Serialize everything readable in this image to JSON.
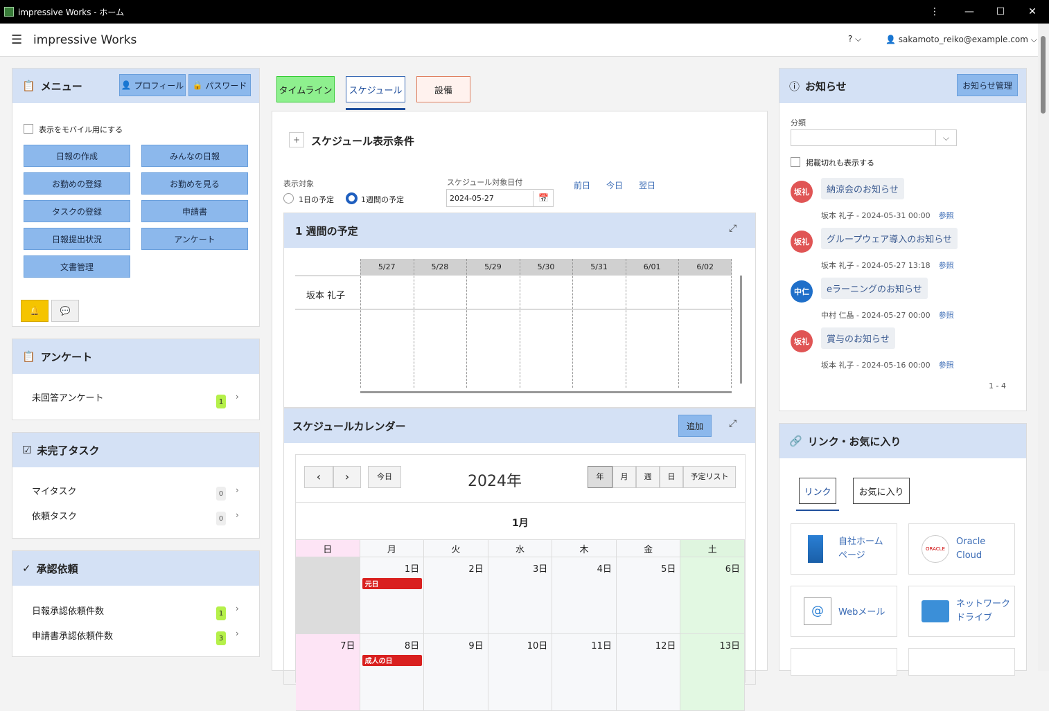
{
  "window": {
    "title": "impressive Works - ホーム",
    "more": "⋮",
    "min": "—",
    "max": "☐",
    "close": "✕"
  },
  "appbar": {
    "brand": "impressive Works",
    "help": "? ⌵",
    "user": "sakamoto_reiko@example.com"
  },
  "menu": {
    "title": "メニュー",
    "profile": "プロフィール",
    "password": "パスワード",
    "mobile_label": "表示をモバイル用にする",
    "buttons": [
      "日報の作成",
      "みんなの日報",
      "お勤めの登録",
      "お勤めを見る",
      "タスクの登録",
      "申請書",
      "日報提出状況",
      "アンケート",
      "文書管理"
    ]
  },
  "survey": {
    "title": "アンケート",
    "row": "未回答アンケート",
    "count": "1"
  },
  "tasks": {
    "title": "未完了タスク",
    "rows": [
      {
        "label": "マイタスク",
        "count": "0"
      },
      {
        "label": "依頼タスク",
        "count": "0"
      }
    ]
  },
  "approval": {
    "title": "承認依頼",
    "rows": [
      {
        "label": "日報承認依頼件数",
        "count": "1"
      },
      {
        "label": "申請書承認依頼件数",
        "count": "3"
      }
    ]
  },
  "tabs": [
    "タイムライン",
    "スケジュール",
    "設備"
  ],
  "cond": {
    "title": "スケジュール表示条件",
    "target_label": "表示対象",
    "opt1": "1日の予定",
    "opt2": "1週間の予定",
    "date_label": "スケジュール対象日付",
    "date_value": "2024-05-27",
    "prev": "前日",
    "today": "今日",
    "next": "翌日"
  },
  "week": {
    "title": "1 週間の予定",
    "days": [
      "5/27",
      "5/28",
      "5/29",
      "5/30",
      "5/31",
      "6/01",
      "6/02"
    ],
    "person": "坂本 礼子"
  },
  "calendar": {
    "title": "スケジュールカレンダー",
    "add": "追加",
    "today": "今日",
    "year": "2024年",
    "views": [
      "年",
      "月",
      "週",
      "日",
      "予定リスト"
    ],
    "month": "1月",
    "weekdays": [
      "日",
      "月",
      "火",
      "水",
      "木",
      "金",
      "土"
    ],
    "row1": [
      "",
      "1日",
      "2日",
      "3日",
      "4日",
      "5日",
      "6日"
    ],
    "row2": [
      "7日",
      "8日",
      "9日",
      "10日",
      "11日",
      "12日",
      "13日"
    ],
    "ev1": "元日",
    "ev2": "成人の日"
  },
  "notices": {
    "title": "お知らせ",
    "manage": "お知らせ管理",
    "category_label": "分類",
    "expired_label": "掲載切れも表示する",
    "items": [
      {
        "avatar": "坂礼",
        "color": "#e05555",
        "title": "納涼会のお知らせ",
        "meta": "坂本 礼子 - 2024-05-31 00:00"
      },
      {
        "avatar": "坂礼",
        "color": "#e05555",
        "title": "グループウェア導入のお知らせ",
        "meta": "坂本 礼子 - 2024-05-27 13:18"
      },
      {
        "avatar": "中仁",
        "color": "#1f6fc9",
        "title": "eラーニングのお知らせ",
        "meta": "中村 仁晶 - 2024-05-27 00:00"
      },
      {
        "avatar": "坂礼",
        "color": "#e05555",
        "title": "賞与のお知らせ",
        "meta": "坂本 礼子 - 2024-05-16 00:00"
      }
    ],
    "ref": "参照",
    "pager": "1 - 4"
  },
  "links": {
    "title": "リンク・お気に入り",
    "tab1": "リンク",
    "tab2": "お気に入り",
    "items": [
      {
        "label": "自社ホーム\nページ"
      },
      {
        "label": "Oracle\nCloud"
      },
      {
        "label": "Webメール"
      },
      {
        "label": "ネットワーク\nドライブ"
      }
    ]
  }
}
